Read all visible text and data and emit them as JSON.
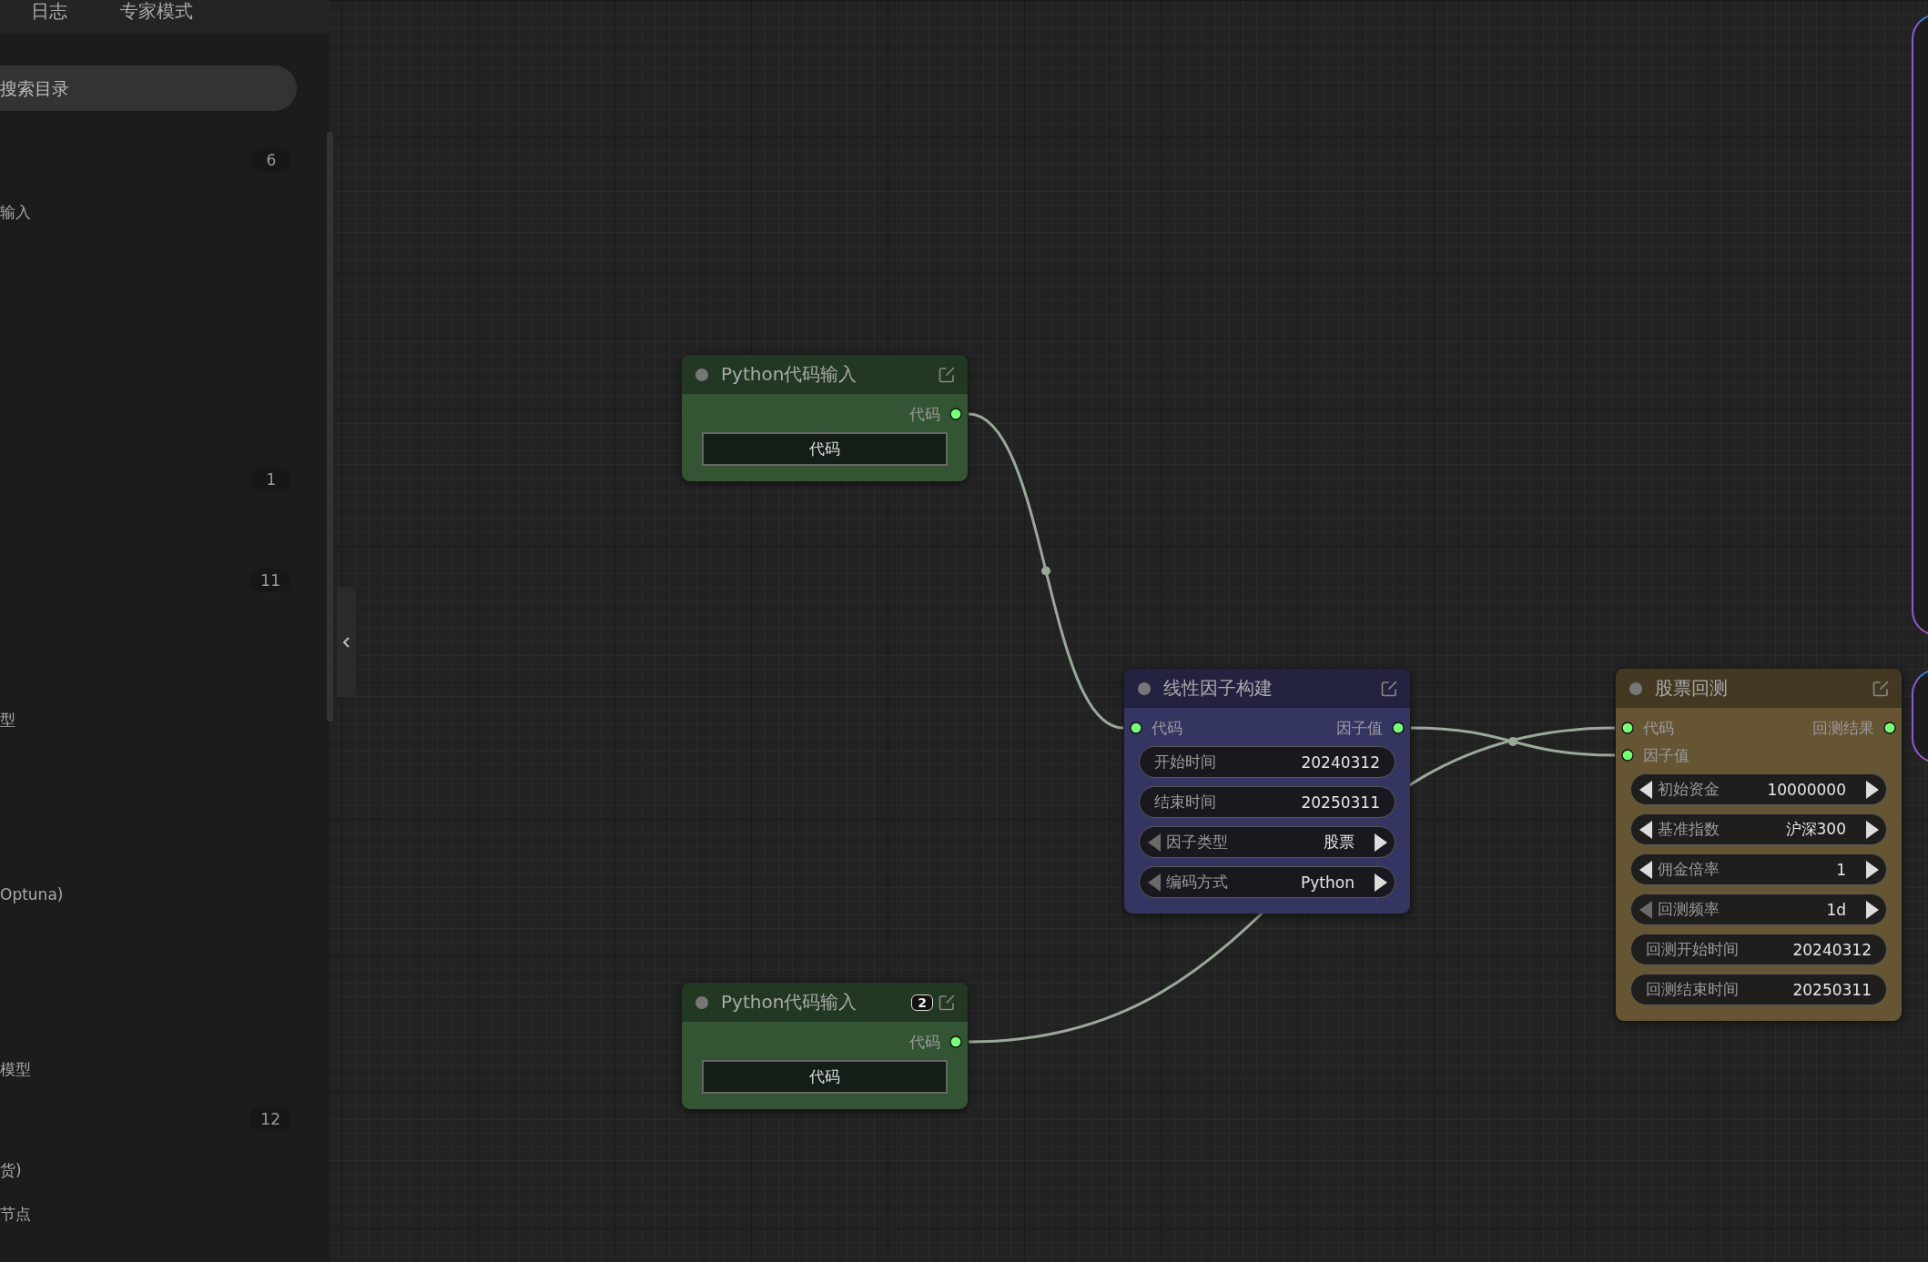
{
  "sidebar": {
    "tabs": [
      {
        "label": "日志",
        "selected": false
      },
      {
        "label": "专家模式",
        "selected": false
      }
    ],
    "search": {
      "placeholder": "搜索目录"
    },
    "items": [
      {
        "kind": "count",
        "text": "6"
      },
      {
        "kind": "label",
        "text": "输入"
      },
      {
        "kind": "count",
        "text": "1"
      },
      {
        "kind": "count",
        "text": "11"
      },
      {
        "kind": "label",
        "text": "型"
      },
      {
        "kind": "label",
        "text": "Optuna)"
      },
      {
        "kind": "label",
        "text": "模型"
      },
      {
        "kind": "count",
        "text": "12"
      },
      {
        "kind": "label",
        "text": "货)"
      },
      {
        "kind": "label",
        "text": "节点"
      }
    ]
  },
  "nodes": [
    {
      "title": "Python代码输入",
      "color": "#345534",
      "outputs": [
        {
          "label": "代码"
        }
      ],
      "widgets": [
        {
          "kind": "button",
          "label": "代码"
        }
      ]
    },
    {
      "title": "线性因子构建",
      "color": "#353562",
      "inputs": [
        {
          "label": "代码"
        }
      ],
      "outputs": [
        {
          "label": "因子值"
        }
      ],
      "widgets": [
        {
          "kind": "text",
          "label": "开始时间",
          "value": "20240312"
        },
        {
          "kind": "text",
          "label": "结束时间",
          "value": "20250311"
        },
        {
          "kind": "combo",
          "label": "因子类型",
          "value": "股票",
          "prev_enabled": false
        },
        {
          "kind": "combo",
          "label": "编码方式",
          "value": "Python",
          "prev_enabled": false
        }
      ]
    },
    {
      "title": "股票回测",
      "color": "#665533",
      "inputs": [
        {
          "label": "代码"
        },
        {
          "label": "因子值"
        }
      ],
      "outputs": [
        {
          "label": "回测结果"
        }
      ],
      "widgets": [
        {
          "kind": "combo",
          "label": "初始资金",
          "value": "10000000",
          "prev_enabled": true
        },
        {
          "kind": "combo",
          "label": "基准指数",
          "value": "沪深300",
          "prev_enabled": true
        },
        {
          "kind": "combo",
          "label": "佣金倍率",
          "value": "1",
          "prev_enabled": true
        },
        {
          "kind": "combo",
          "label": "回测频率",
          "value": "1d",
          "prev_enabled": false
        },
        {
          "kind": "text",
          "label": "回测开始时间",
          "value": "20240312"
        },
        {
          "kind": "text",
          "label": "回测结束时间",
          "value": "20250311"
        }
      ]
    },
    {
      "title": "Python代码输入",
      "color": "#345534",
      "badge": "2",
      "outputs": [
        {
          "label": "代码"
        }
      ],
      "widgets": [
        {
          "kind": "button",
          "label": "代码"
        }
      ]
    }
  ]
}
